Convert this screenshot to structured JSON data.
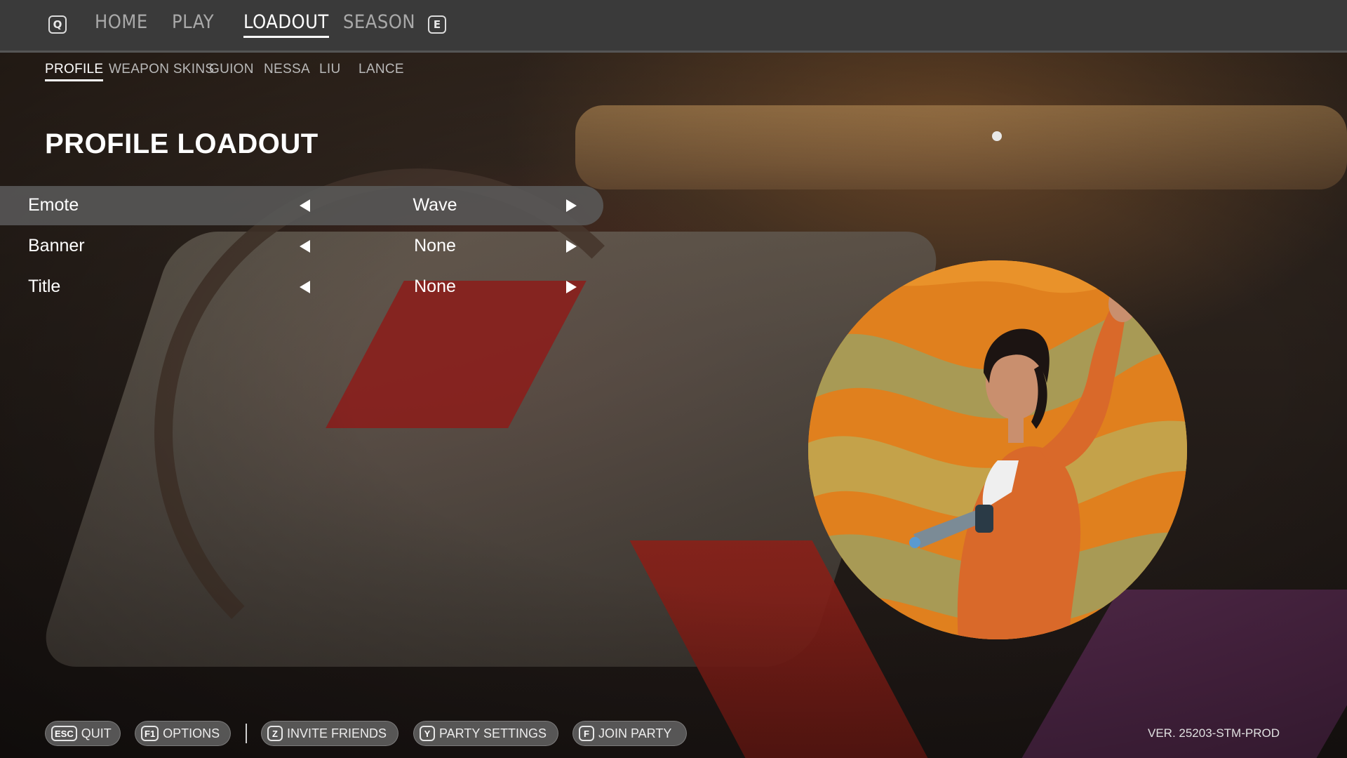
{
  "nav": {
    "prev_key": "Q",
    "next_key": "E",
    "tabs": [
      {
        "label": "HOME",
        "active": false
      },
      {
        "label": "PLAY",
        "active": false
      },
      {
        "label": "LOADOUT",
        "active": true
      },
      {
        "label": "SEASON",
        "active": false
      }
    ]
  },
  "sub_tabs": [
    {
      "label": "PROFILE",
      "active": true
    },
    {
      "label": "WEAPON SKINS",
      "active": false
    },
    {
      "label": "GUION",
      "active": false
    },
    {
      "label": "NESSA",
      "active": false
    },
    {
      "label": "LIU",
      "active": false
    },
    {
      "label": "LANCE",
      "active": false
    }
  ],
  "panel": {
    "title": "PROFILE LOADOUT",
    "options": [
      {
        "label": "Emote",
        "value": "Wave",
        "selected": true
      },
      {
        "label": "Banner",
        "value": "None",
        "selected": false
      },
      {
        "label": "Title",
        "value": "None",
        "selected": false
      }
    ]
  },
  "footer": {
    "buttons": [
      {
        "key": "ESC",
        "label": "QUIT"
      },
      {
        "key": "F1",
        "label": "OPTIONS"
      },
      {
        "key": "Z",
        "label": "INVITE FRIENDS"
      },
      {
        "key": "Y",
        "label": "PARTY SETTINGS"
      },
      {
        "key": "F",
        "label": "JOIN PARTY"
      }
    ],
    "version": "VER. 25203-STM-PROD"
  },
  "colors": {
    "top_bar": "#3a3a3a",
    "selected_row": "#5a5a5a",
    "portrait_orange": "#e0801e",
    "portrait_olive": "#a89a55"
  },
  "icons": {
    "option_prev": "left-triangle-icon",
    "option_next": "right-triangle-icon"
  }
}
